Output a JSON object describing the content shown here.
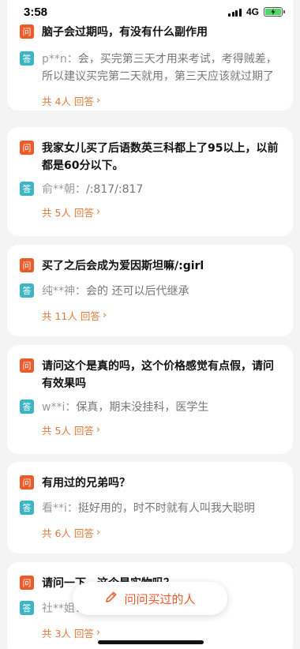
{
  "status_bar": {
    "time": "3:58",
    "network": "4G"
  },
  "labels": {
    "question_badge": "问",
    "answer_badge": "答"
  },
  "questions": [
    {
      "question": "脑子会过期吗，有没有什么副作用",
      "user": "p**n：",
      "answer": "会，买完第三天才用来考试，考得贼差，所以建议买完第二天就用，第三天应该就过期了",
      "count": "共 4人 回答"
    },
    {
      "question": "我家女儿买了后语数英三科都上了95以上，以前都是60分以下。",
      "user": "俞**朝：",
      "answer": "/:817/:817",
      "count": "共 5人 回答"
    },
    {
      "question": "买了之后会成为爱因斯坦嘛/:girl",
      "user": "纯**神：",
      "answer": "会的 还可以后代继承",
      "count": "共 11人 回答"
    },
    {
      "question": "请问这个是真的吗，这个价格感觉有点假，请问有效果吗",
      "user": "w**i：",
      "answer": "保真，期末没挂科，医学生",
      "count": "共 5人 回答"
    },
    {
      "question": "有用过的兄弟吗？",
      "user": "看**i：",
      "answer": "挺好用的，时不时就有人叫我大聪明",
      "count": "共 6人 回答"
    },
    {
      "question": "请问一下，这个是实物吗？",
      "user": "社**姐：",
      "answer": "",
      "count": "共 3人 回答"
    }
  ],
  "ask_button": {
    "label": "问问买过的人",
    "icon": "pencil-icon"
  },
  "colors": {
    "accent": "#ee5b2a",
    "answer_badge": "#3cb6c6",
    "link": "#e07a3a"
  }
}
